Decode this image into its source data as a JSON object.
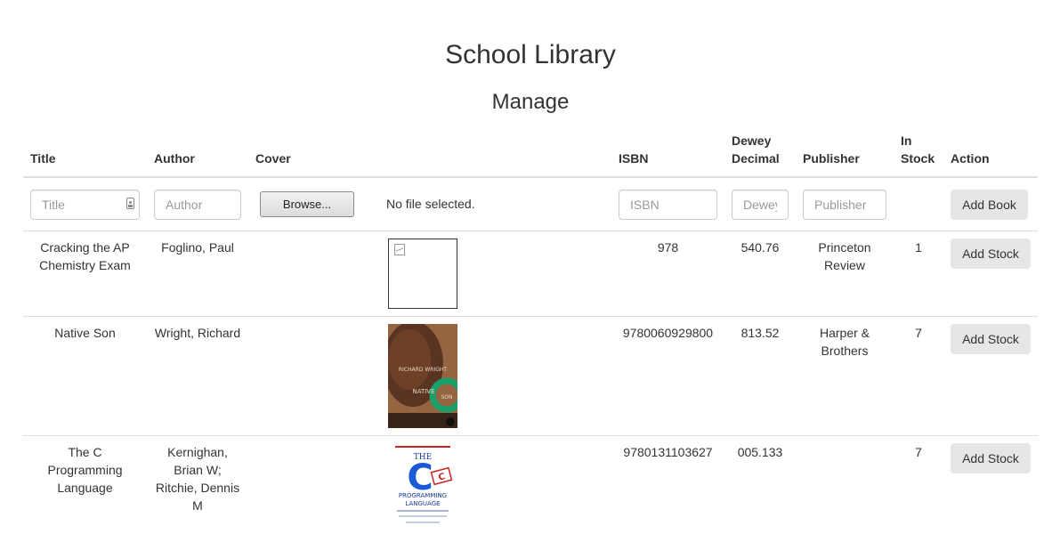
{
  "page": {
    "title": "School Library",
    "subtitle": "Manage"
  },
  "table": {
    "headers": {
      "title": "Title",
      "author": "Author",
      "cover": "Cover",
      "isbn": "ISBN",
      "dewey": "Dewey Decimal",
      "publisher": "Publisher",
      "stock": "In Stock",
      "action": "Action"
    },
    "form": {
      "title_placeholder": "Title",
      "author_placeholder": "Author",
      "browse_label": "Browse...",
      "no_file_text": "No file selected.",
      "isbn_placeholder": "ISBN",
      "dewey_placeholder": "Dewey",
      "publisher_placeholder": "Publisher",
      "add_book_label": "Add Book"
    },
    "rows": [
      {
        "title": "Cracking the AP Chemistry Exam",
        "author": "Foglino, Paul",
        "cover": "broken-image-icon",
        "isbn": "978",
        "dewey": "540.76",
        "publisher": "Princeton Review",
        "stock": "1",
        "action": "Add Stock"
      },
      {
        "title": "Native Son",
        "author": "Wright, Richard",
        "cover": "native-son-cover",
        "cover_text": "RICHARD WRIGHT NATIVE SON",
        "isbn": "9780060929800",
        "dewey": "813.52",
        "publisher": "Harper & Brothers",
        "stock": "7",
        "action": "Add Stock"
      },
      {
        "title": "The C Programming Language",
        "author": "Kernighan, Brian W; Ritchie, Dennis M",
        "cover": "c-programming-cover",
        "cover_text": "THE C PROGRAMMING LANGUAGE",
        "isbn": "9780131103627",
        "dewey": "005.133",
        "publisher": "",
        "stock": "7",
        "action": "Add Stock"
      }
    ]
  },
  "colors": {
    "text": "#333333",
    "border": "#dddddd",
    "button_bg": "#e6e6e6"
  }
}
